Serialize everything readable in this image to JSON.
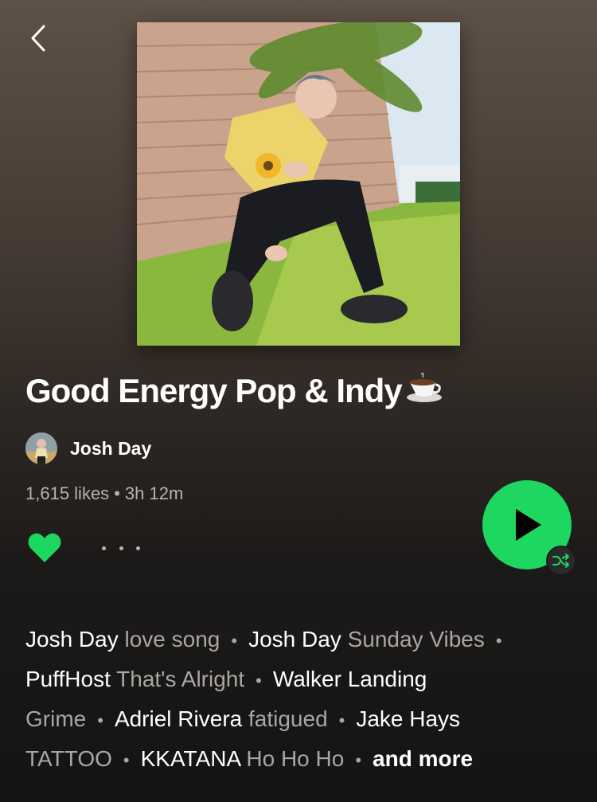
{
  "navigation": {
    "back_icon": "chevron-left-icon"
  },
  "playlist": {
    "title": "Good Energy Pop & Indy",
    "title_emoji": "coffee-cup-icon",
    "owner_name": "Josh Day",
    "likes": "1,615 likes",
    "separator": "•",
    "duration": "3h 12m",
    "liked": true
  },
  "colors": {
    "accent": "#1ed760",
    "muted_text": "#b8b3af"
  },
  "featured": {
    "items": [
      {
        "artist": "Josh Day",
        "song": "love song"
      },
      {
        "artist": "Josh Day",
        "song": "Sunday Vibes"
      },
      {
        "artist": "PuffHost",
        "song": "That's Alright"
      },
      {
        "artist": "Walker Landing",
        "song": "Grime"
      },
      {
        "artist": "Adriel Rivera",
        "song": "fatigued"
      },
      {
        "artist": "Jake Hays",
        "song": "TATTOO"
      },
      {
        "artist": "KKATANA",
        "song": "Ho Ho Ho"
      }
    ],
    "separator": "•",
    "more_label": "and more"
  }
}
